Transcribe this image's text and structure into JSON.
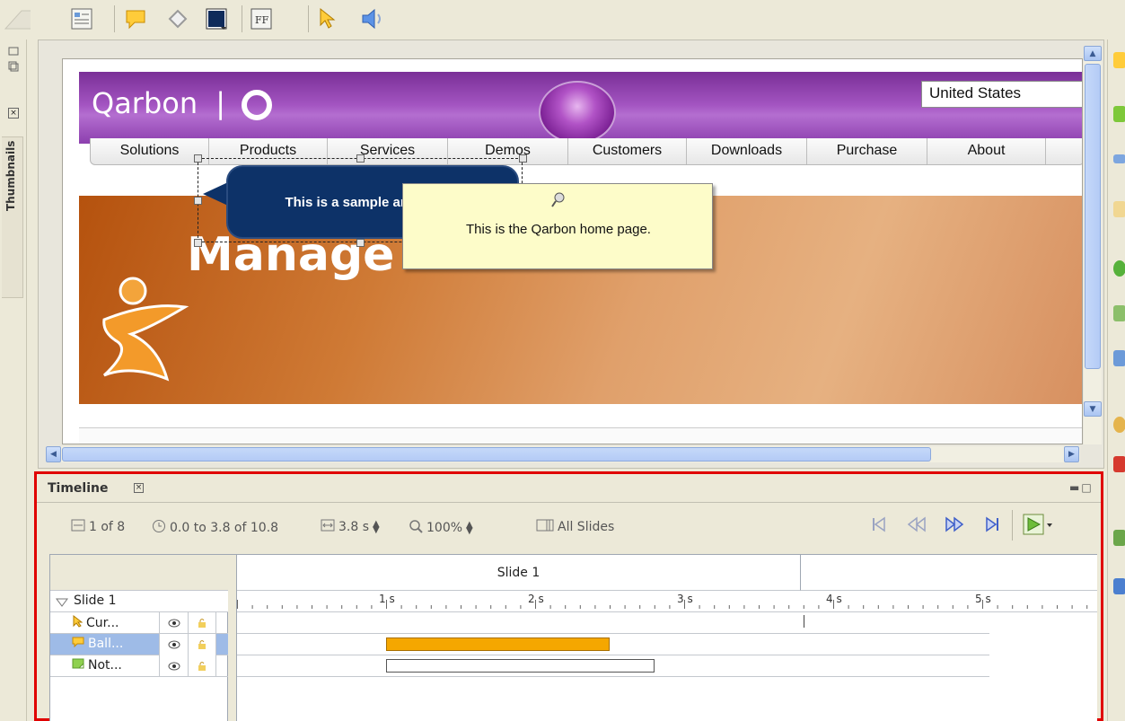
{
  "slide_content": {
    "logo_text": "Qarbon",
    "country": "United States",
    "nav": [
      "Solutions",
      "Products",
      "Services",
      "Demos",
      "Customers",
      "Downloads",
      "Purchase",
      "About"
    ],
    "banner_heading": "Manage",
    "callout_text": "This is a sample animation.",
    "note_text": "This is the Qarbon home page."
  },
  "left_panel": {
    "tab_label": "Thumbnails"
  },
  "timeline": {
    "tab_label": "Timeline",
    "controls": {
      "slide_position": "1 of 8",
      "time_range": "0.0 to 3.8 of 10.8",
      "duration": "3.8 s",
      "zoom": "100%",
      "scope": "All Slides"
    },
    "slide_header": "Slide 1",
    "ruler": [
      "1 s",
      "2 s",
      "3 s",
      "4 s",
      "5 s"
    ],
    "tree_root": "Slide 1",
    "layers": [
      {
        "label": "Cur...",
        "type": "cursor",
        "selected": false
      },
      {
        "label": "Ball...",
        "type": "balloon",
        "selected": true
      },
      {
        "label": "Not...",
        "type": "note",
        "selected": false
      }
    ],
    "bars": [
      {
        "layer": "Ball...",
        "start_s": 1.0,
        "end_s": 2.5,
        "color": "#f5a700"
      },
      {
        "layer": "Not...",
        "start_s": 1.0,
        "end_s": 2.8,
        "color": "#ffffff"
      }
    ],
    "playhead_s": 3.8
  },
  "colors": {
    "highlight_border": "#e00000",
    "selected_row": "#9ebbe7",
    "balloon_bar": "#f5a700"
  }
}
